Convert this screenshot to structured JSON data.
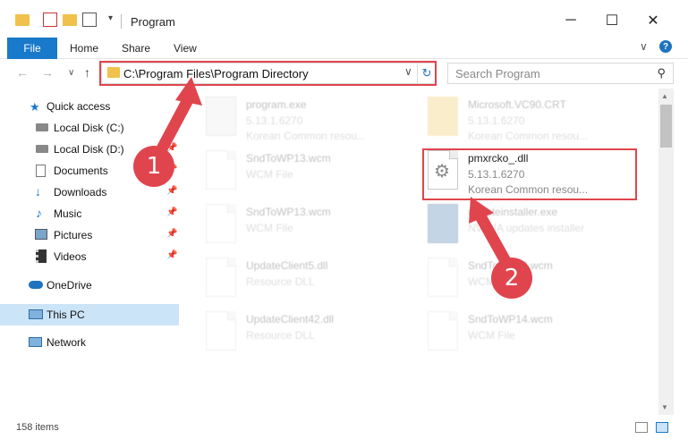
{
  "window": {
    "title": "Program",
    "minimize": "─",
    "maximize": "☐",
    "close": "✕"
  },
  "ribbon": {
    "file": "File",
    "home": "Home",
    "share": "Share",
    "view": "View",
    "expand": "∨"
  },
  "nav": {
    "back": "←",
    "forward": "→",
    "recent": "∨",
    "up": "↑",
    "address": "C:\\Program Files\\Program Directory",
    "search_placeholder": "Search Program"
  },
  "sidebar": {
    "items": [
      {
        "label": "Quick access"
      },
      {
        "label": "Local Disk (C:)"
      },
      {
        "label": "Local Disk (D:)"
      },
      {
        "label": "Documents"
      },
      {
        "label": "Downloads"
      },
      {
        "label": "Music"
      },
      {
        "label": "Pictures"
      },
      {
        "label": "Videos"
      },
      {
        "label": "OneDrive"
      },
      {
        "label": "This PC"
      },
      {
        "label": "Network"
      }
    ]
  },
  "files": [
    {
      "name": "program.exe",
      "line2": "5.13.1.6270",
      "line3": "Korean Common resou..."
    },
    {
      "name": "Microsoft.VC90.CRT",
      "line2": "5.13.1.6270",
      "line3": "Korean Common resou..."
    },
    {
      "name": "SndToWP13.wcm",
      "line2": "WCM File",
      "line3": ""
    },
    {
      "name": "pmxrcko_.dll",
      "line2": "5.13.1.6270",
      "line3": "Korean Common resou..."
    },
    {
      "name": "SndToWP13.wcm",
      "line2": "WCM File",
      "line3": ""
    },
    {
      "name": "updateinstaller.exe",
      "line2": "NVIDIA updates installer",
      "line3": ""
    },
    {
      "name": "UpdateClient5.dll",
      "line2": "Resource DLL",
      "line3": ""
    },
    {
      "name": "SndToWP13.wcm",
      "line2": "WCM File",
      "line3": ""
    },
    {
      "name": "UpdateClient42.dll",
      "line2": "Resource DLL",
      "line3": ""
    },
    {
      "name": "SndToWP14.wcm",
      "line2": "WCM File",
      "line3": ""
    }
  ],
  "status": {
    "count": "158 items"
  },
  "callouts": {
    "one": "1",
    "two": "2"
  },
  "colors": {
    "accent": "#1979ca",
    "highlight": "#e0454d",
    "selected": "#cce4f7"
  }
}
